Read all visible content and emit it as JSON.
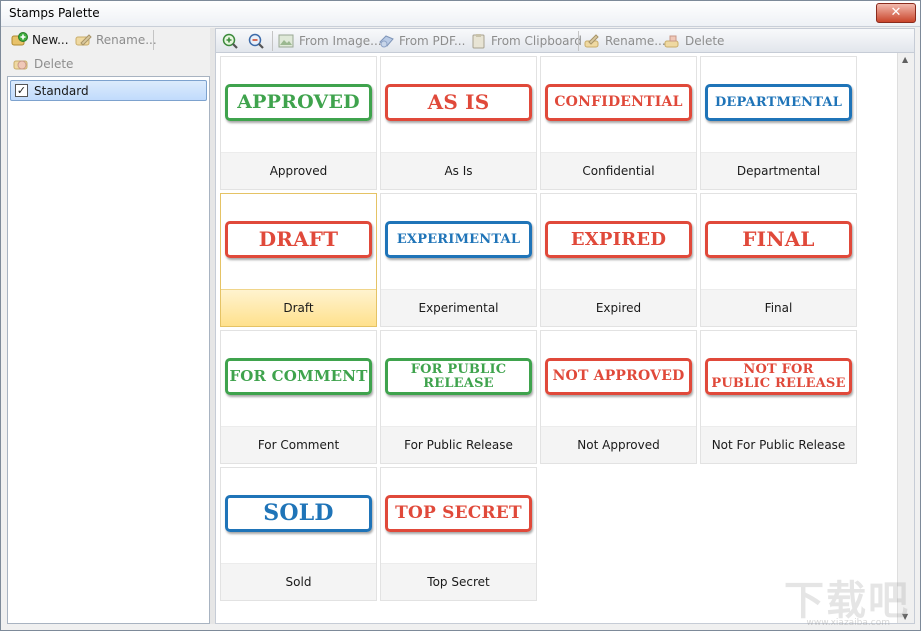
{
  "window": {
    "title": "Stamps Palette",
    "close_glyph": "✕"
  },
  "left_toolbar": {
    "new_label": "New...",
    "rename_label": "Rename...",
    "delete_label": "Delete"
  },
  "categories": [
    {
      "label": "Standard",
      "checked": true
    }
  ],
  "right_toolbar": {
    "from_image_label": "From Image...",
    "from_pdf_label": "From PDF...",
    "from_clipboard_label": "From Clipboard",
    "rename_label": "Rename...",
    "delete_label": "Delete"
  },
  "stamps": [
    {
      "name": "Approved",
      "text": "APPROVED",
      "color": "#3fa34d",
      "size": 19
    },
    {
      "name": "As Is",
      "text": "AS IS",
      "color": "#e0493a",
      "size": 20
    },
    {
      "name": "Confidential",
      "text": "CONFIDENTIAL",
      "color": "#e0493a",
      "size": 14
    },
    {
      "name": "Departmental",
      "text": "DEPARTMENTAL",
      "color": "#1f74b8",
      "size": 13
    },
    {
      "name": "Draft",
      "text": "DRAFT",
      "color": "#e0493a",
      "size": 20
    },
    {
      "name": "Experimental",
      "text": "EXPERIMENTAL",
      "color": "#1f74b8",
      "size": 13
    },
    {
      "name": "Expired",
      "text": "EXPIRED",
      "color": "#e0493a",
      "size": 18
    },
    {
      "name": "Final",
      "text": "FINAL",
      "color": "#e0493a",
      "size": 20
    },
    {
      "name": "For Comment",
      "text": "FOR COMMENT",
      "color": "#3fa34d",
      "size": 15
    },
    {
      "name": "For Public Release",
      "text": "FOR PUBLIC\nRELEASE",
      "color": "#3fa34d",
      "size": 13
    },
    {
      "name": "Not Approved",
      "text": "NOT APPROVED",
      "color": "#e0493a",
      "size": 14
    },
    {
      "name": "Not For Public Release",
      "text": "NOT FOR\nPUBLIC RELEASE",
      "color": "#e0493a",
      "size": 13
    },
    {
      "name": "Sold",
      "text": "SOLD",
      "color": "#1f74b8",
      "size": 22
    },
    {
      "name": "Top Secret",
      "text": "TOP SECRET",
      "color": "#e0493a",
      "size": 17
    }
  ],
  "selected_stamp": "Draft",
  "watermark": {
    "text": "下载吧",
    "url": "www.xiazaiba.com"
  }
}
